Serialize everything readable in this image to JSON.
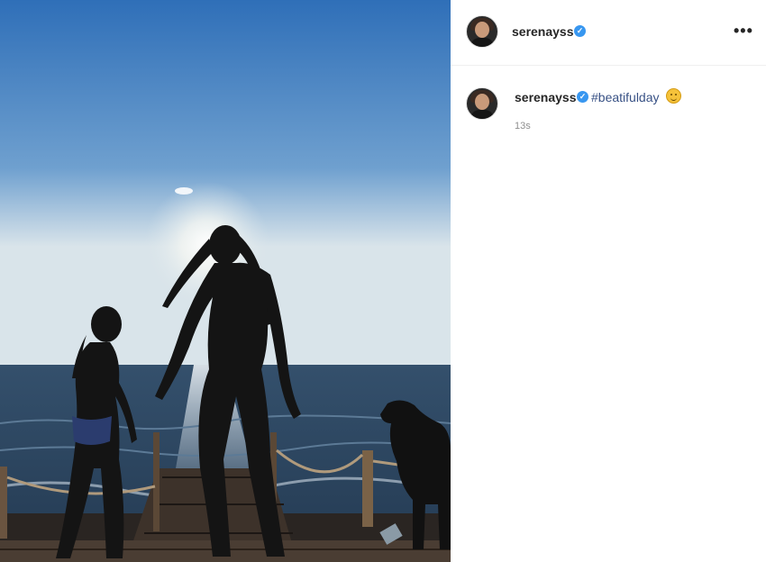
{
  "post": {
    "username": "serenayss",
    "verified_mark": "✓",
    "more_label": "•••",
    "caption_username": "serenayss",
    "hashtag": "#beatifulday",
    "emoji": "smiling-sun-emoji",
    "timestamp": "13s"
  },
  "colors": {
    "sky_top": "#2f6fb8",
    "sky_horizon": "#d9e4ea",
    "sea": "#3a5a78",
    "verified": "#3897f0",
    "hashtag": "#385185"
  }
}
